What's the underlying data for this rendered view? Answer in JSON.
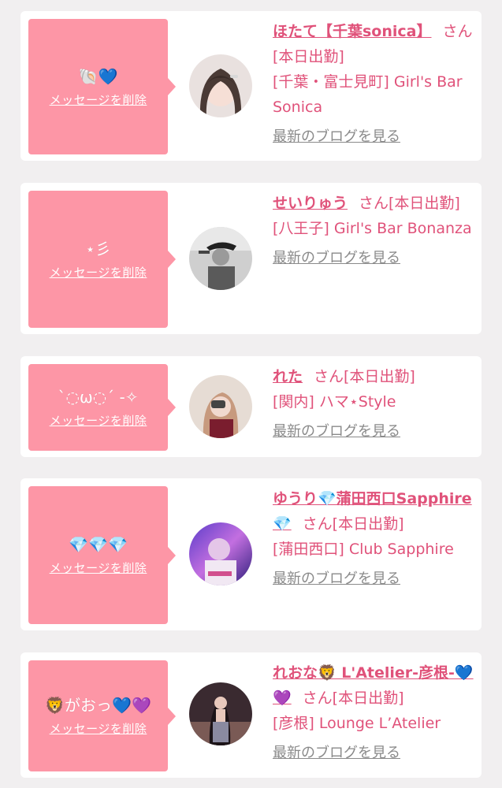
{
  "delete_label": "メッセージを削除",
  "blog_label": "最新のブログを見る",
  "cards": [
    {
      "message": "🐚💙",
      "name": "ほたて【千葉sonica】",
      "suffix": "さん[本日出勤]",
      "shop": "[千葉・富士見町] Girl's Bar Sonica"
    },
    {
      "message": "⋆彡",
      "name": "せいりゅう",
      "suffix": "さん[本日出勤]",
      "shop": "[八王子] Girl's Bar Bonanza"
    },
    {
      "message": "ˋ◌ω◌ˊ -✧",
      "name": "れた",
      "suffix": "さん[本日出勤]",
      "shop": "[関内] ハマ⋆Style"
    },
    {
      "message": "💎💎💎",
      "name": "ゆうり💎蒲田西口Sapphire💎",
      "suffix": "さん[本日出勤]",
      "shop": "[蒲田西口] Club Sapphire"
    },
    {
      "message": "🦁がおっ💙💜",
      "name": "れおな🦁 L'Atelier-彦根-💙💜",
      "suffix": "さん[本日出勤]",
      "shop": "[彦根] Lounge L’Atelier"
    }
  ],
  "colors": {
    "accent_pink": "#fd96a6",
    "text_pink": "#e0527a",
    "link_gray": "#8a8a8a",
    "background": "#f1eff0"
  }
}
